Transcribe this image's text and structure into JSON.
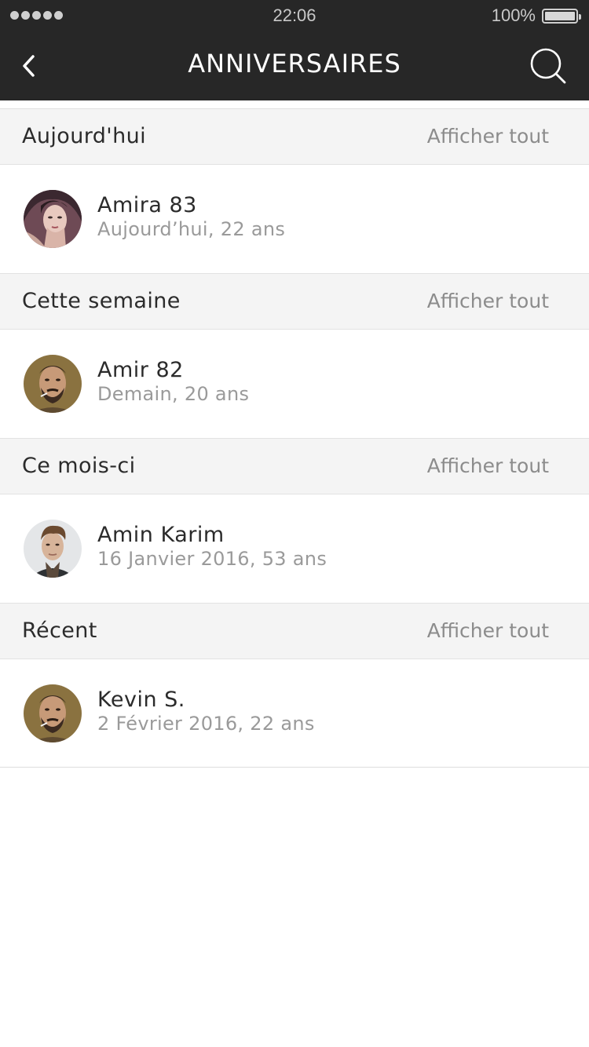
{
  "status_bar": {
    "time": "22:06",
    "battery": "100%"
  },
  "header": {
    "title": "ANNIVERSAIRES",
    "back_icon": "chevron-left-icon",
    "search_icon": "search-icon"
  },
  "sections": [
    {
      "title": "Aujourd'hui",
      "see_all": "Afficher tout",
      "item": {
        "name": "Amira 83",
        "detail": "Aujourd’hui, 22 ans"
      }
    },
    {
      "title": "Cette semaine",
      "see_all": "Afficher tout",
      "item": {
        "name": "Amir 82",
        "detail": "Demain, 20 ans"
      }
    },
    {
      "title": "Ce mois-ci",
      "see_all": "Afficher tout",
      "item": {
        "name": "Amin Karim",
        "detail": "16 Janvier 2016, 53 ans"
      }
    },
    {
      "title": "Récent",
      "see_all": "Afficher tout",
      "item": {
        "name": "Kevin S.",
        "detail": "2 Février 2016, 22 ans"
      }
    }
  ],
  "colors": {
    "header_bg": "#272727",
    "section_bg": "#f4f4f4",
    "secondary_text": "#9a9a9a"
  }
}
